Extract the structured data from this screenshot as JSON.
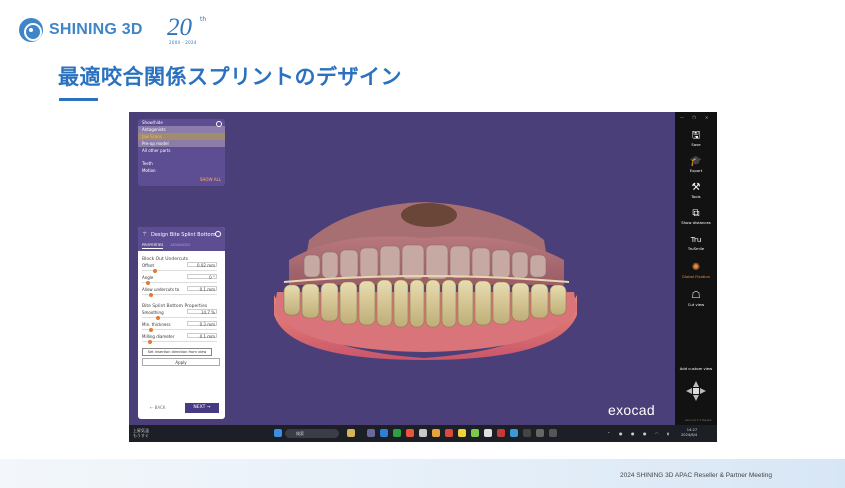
{
  "header": {
    "logo_text": "SHINING 3D",
    "anniversary_number": "20",
    "anniversary_sup": "th",
    "anniversary_years": "2004 - 2024"
  },
  "slide": {
    "title": "最適咬合関係スプリントのデザイン",
    "footer": "2024 SHINING 3D APAC Reseller & Partner Meeting"
  },
  "tree_panel": {
    "rows": [
      "Show/hide",
      "Antagonists",
      "Jaw Scans",
      "Pre-op model",
      "All other parts",
      "Teeth",
      "Motion"
    ],
    "show_all": "SHOW ALL"
  },
  "design_dialog": {
    "title": "Design Bite Splint Bottom",
    "tab_properties": "PROPERTIES",
    "tab_other": "ADVANCED",
    "section1": "Block Out Undercuts",
    "params1": [
      {
        "label": "Offset",
        "value": "0.02 mm",
        "level": 0.15
      },
      {
        "label": "Angle",
        "value": "0 °",
        "level": 0.05
      },
      {
        "label": "Allow undercuts to",
        "value": "0.1 mm",
        "level": 0.1
      }
    ],
    "section2": "Bite Splint Bottom Properties",
    "params2": [
      {
        "label": "Smoothing",
        "value": "14.7 %",
        "level": 0.2
      },
      {
        "label": "Min. thickness",
        "value": "0.3 mm",
        "level": 0.1
      },
      {
        "label": "Milling diameter",
        "value": "0.1 mm",
        "level": 0.08
      }
    ],
    "btn_direction": "Set insertion direction from view",
    "btn_apply": "Apply",
    "btn_back": "BACK",
    "btn_next": "NEXT"
  },
  "watermark": "exocad",
  "toolbar": {
    "items": [
      {
        "label": "Save",
        "icon": "save-icon",
        "glyph": "🖫"
      },
      {
        "label": "Export",
        "icon": "export-icon",
        "glyph": "🎓"
      },
      {
        "label": "Tools",
        "icon": "tools-icon",
        "glyph": "⚒"
      },
      {
        "label": "Show distances",
        "icon": "distances-icon",
        "glyph": "⧉"
      },
      {
        "label": "TruSmile",
        "icon": "trusmile-icon",
        "glyph": "Tru"
      },
      {
        "label": "Global Fixation",
        "icon": "fixation-icon",
        "glyph": "✺"
      },
      {
        "label": "Cut view",
        "icon": "cut-view-icon",
        "glyph": "☖"
      }
    ],
    "add_view": "Add custom view",
    "version": "exocad 3.1 Rijeka"
  },
  "taskbar": {
    "weather_temp": "上昇気温",
    "weather_sub": "もうすぐ",
    "search": "検索",
    "time": "14:27",
    "date": "2024/6/4"
  },
  "colors": {
    "brand_blue": "#2a72c0",
    "viewport_bg": "#4a3f78",
    "panel_purple": "#5d4e94",
    "accent_orange": "#f08a3c"
  }
}
